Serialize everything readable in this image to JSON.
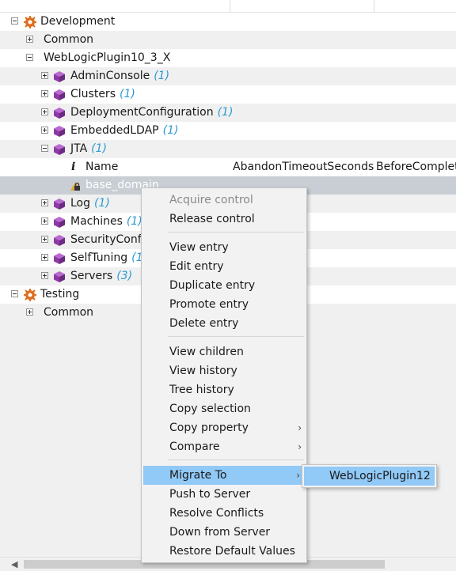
{
  "columns": {
    "name": "Name",
    "col2": "AbandonTimeoutSeconds",
    "col3": "BeforeComplet"
  },
  "tree": {
    "development": "Development",
    "dev_common": "Common",
    "weblogic_plugin": "WebLogicPlugin10_3_X",
    "admin_console": {
      "label": "AdminConsole",
      "count": "(1)"
    },
    "clusters": {
      "label": "Clusters",
      "count": "(1)"
    },
    "deployment_configuration": {
      "label": "DeploymentConfiguration",
      "count": "(1)"
    },
    "embedded_ldap": {
      "label": "EmbeddedLDAP",
      "count": "(1)"
    },
    "jta": {
      "label": "JTA",
      "count": "(1)"
    },
    "base_domain": "base_domain",
    "log": {
      "label": "Log",
      "count": "(1)"
    },
    "machines": {
      "label": "Machines",
      "count": "(1)"
    },
    "security_config": {
      "label": "SecurityConfi",
      "count": ""
    },
    "self_tuning": {
      "label": "SelfTuning",
      "count": "(1"
    },
    "servers": {
      "label": "Servers",
      "count": "(3)"
    },
    "testing": "Testing",
    "test_common": "Common"
  },
  "context_menu": {
    "acquire_control": "Acquire control",
    "release_control": "Release control",
    "view_entry": "View entry",
    "edit_entry": "Edit entry",
    "duplicate_entry": "Duplicate entry",
    "promote_entry": "Promote entry",
    "delete_entry": "Delete entry",
    "view_children": "View children",
    "view_history": "View history",
    "tree_history": "Tree history",
    "copy_selection": "Copy selection",
    "copy_property": "Copy property",
    "compare": "Compare",
    "migrate_to": "Migrate To",
    "push_to_server": "Push to Server",
    "resolve_conflicts": "Resolve Conflicts",
    "down_from_server": "Down from Server",
    "restore_default_values": "Restore Default Values"
  },
  "submenu": {
    "weblogic_plugin12": "WebLogicPlugin12"
  },
  "colors": {
    "highlight": "#91c9f7",
    "count": "#2c9ad1",
    "cube": "#8e3aa6",
    "gear": "#e06e1e"
  }
}
